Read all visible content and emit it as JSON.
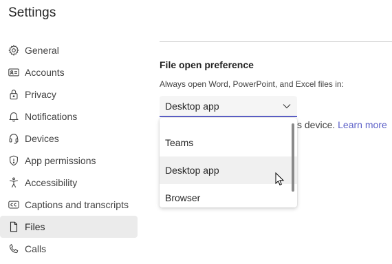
{
  "page": {
    "title": "Settings"
  },
  "sidebar": {
    "items": [
      {
        "label": "General",
        "icon": "gear-icon"
      },
      {
        "label": "Accounts",
        "icon": "id-card-icon"
      },
      {
        "label": "Privacy",
        "icon": "lock-icon"
      },
      {
        "label": "Notifications",
        "icon": "bell-icon"
      },
      {
        "label": "Devices",
        "icon": "headset-icon"
      },
      {
        "label": "App permissions",
        "icon": "shield-icon"
      },
      {
        "label": "Accessibility",
        "icon": "accessibility-icon"
      },
      {
        "label": "Captions and transcripts",
        "icon": "captions-icon"
      },
      {
        "label": "Files",
        "icon": "file-icon",
        "selected": true
      },
      {
        "label": "Calls",
        "icon": "phone-icon"
      }
    ]
  },
  "file_open": {
    "heading": "File open preference",
    "description": "Always open Word, PowerPoint, and Excel files in:",
    "selected_value": "Desktop app",
    "options": [
      "Teams",
      "Desktop app",
      "Browser"
    ],
    "hovered_option": "Desktop app"
  },
  "behind_dropdown": {
    "text_fragment": "s device.",
    "link": "Learn more"
  },
  "colors": {
    "accent": "#5b5fc7",
    "selected_nav_bg": "#ebebeb"
  }
}
